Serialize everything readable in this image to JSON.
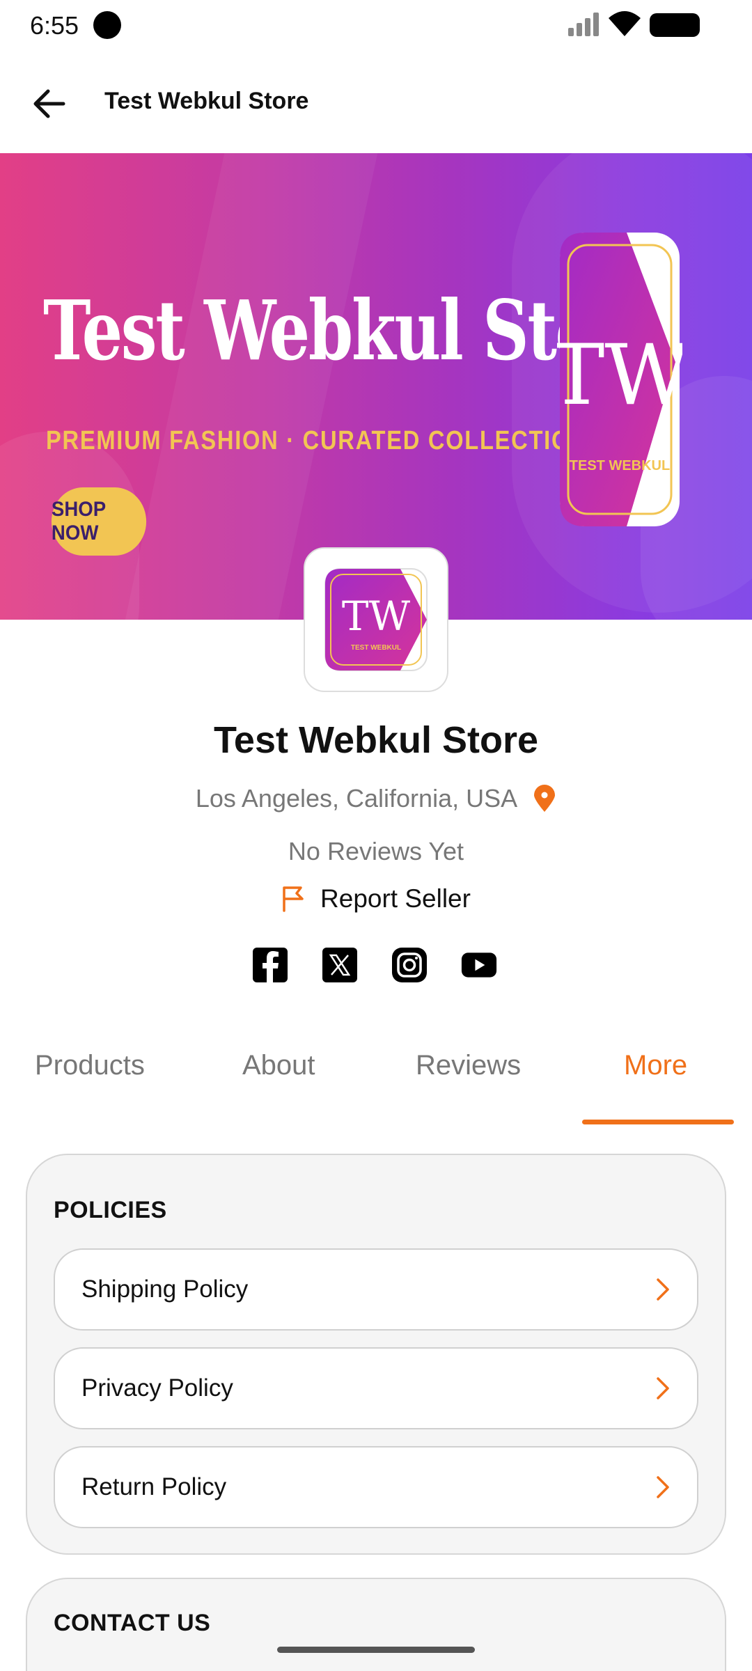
{
  "status": {
    "time": "6:55"
  },
  "app_bar": {
    "title": "Test Webkul Store"
  },
  "banner": {
    "title": "Test Webkul Store",
    "tagline": "PREMIUM FASHION · CURATED COLLECTIONS",
    "cta": "SHOP NOW",
    "logo_initials": "TW",
    "logo_subtext": "TEST WEBKUL",
    "colors": {
      "gradient_start": "#e23f86",
      "gradient_end": "#7a3ee8",
      "accent_yellow": "#f2c553"
    }
  },
  "store": {
    "name": "Test Webkul Store",
    "location": "Los Angeles, California, USA",
    "reviews": "No Reviews Yet",
    "report_label": "Report Seller",
    "social": [
      "facebook-icon",
      "x-icon",
      "instagram-icon",
      "youtube-icon"
    ]
  },
  "tabs": [
    {
      "label": "Products",
      "active": false
    },
    {
      "label": "About",
      "active": false
    },
    {
      "label": "Reviews",
      "active": false
    },
    {
      "label": "More",
      "active": true
    }
  ],
  "policies": {
    "title": "POLICIES",
    "items": [
      {
        "label": "Shipping Policy"
      },
      {
        "label": "Privacy Policy"
      },
      {
        "label": "Return Policy"
      }
    ]
  },
  "contact": {
    "title": "CONTACT US"
  },
  "colors": {
    "accent": "#f07019",
    "text": "#111111",
    "muted": "#777777"
  }
}
